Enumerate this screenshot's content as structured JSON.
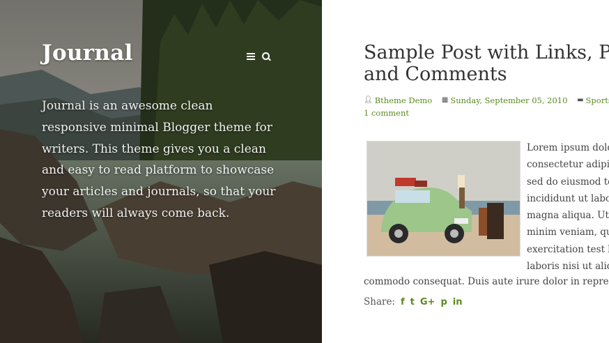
{
  "blog": {
    "title": "Journal",
    "description": "Journal is an awesome clean responsive minimal Blogger theme for writers. This theme gives you a clean and easy to read platform to showcase your articles and journals, so that your readers will always come back."
  },
  "header_icons": [
    "menu-icon",
    "search-icon"
  ],
  "post": {
    "title_line1": "Sample Post with Links, Parag",
    "title_line2": "and Comments",
    "author": "Btheme Demo",
    "date": "Sunday, September 05, 2010",
    "labels": "Sports, Web De",
    "comments": "1 comment",
    "body_lines": [
      "Lorem ipsum dolo",
      "consectetur adipis",
      "sed do eiusmod te",
      "incididunt ut labo",
      "magna aliqua. Ut e",
      "minim veniam, qu",
      "exercitation test l",
      "laboris nisi ut aliq"
    ],
    "body_last": "commodo consequat. Duis aute irure dolor in repreher",
    "share_label": "Share:",
    "share_icons": [
      "f",
      "t",
      "G+",
      "p",
      "in"
    ]
  },
  "colors": {
    "accent": "#5a8a1e",
    "title": "#333333",
    "text": "#444444"
  }
}
